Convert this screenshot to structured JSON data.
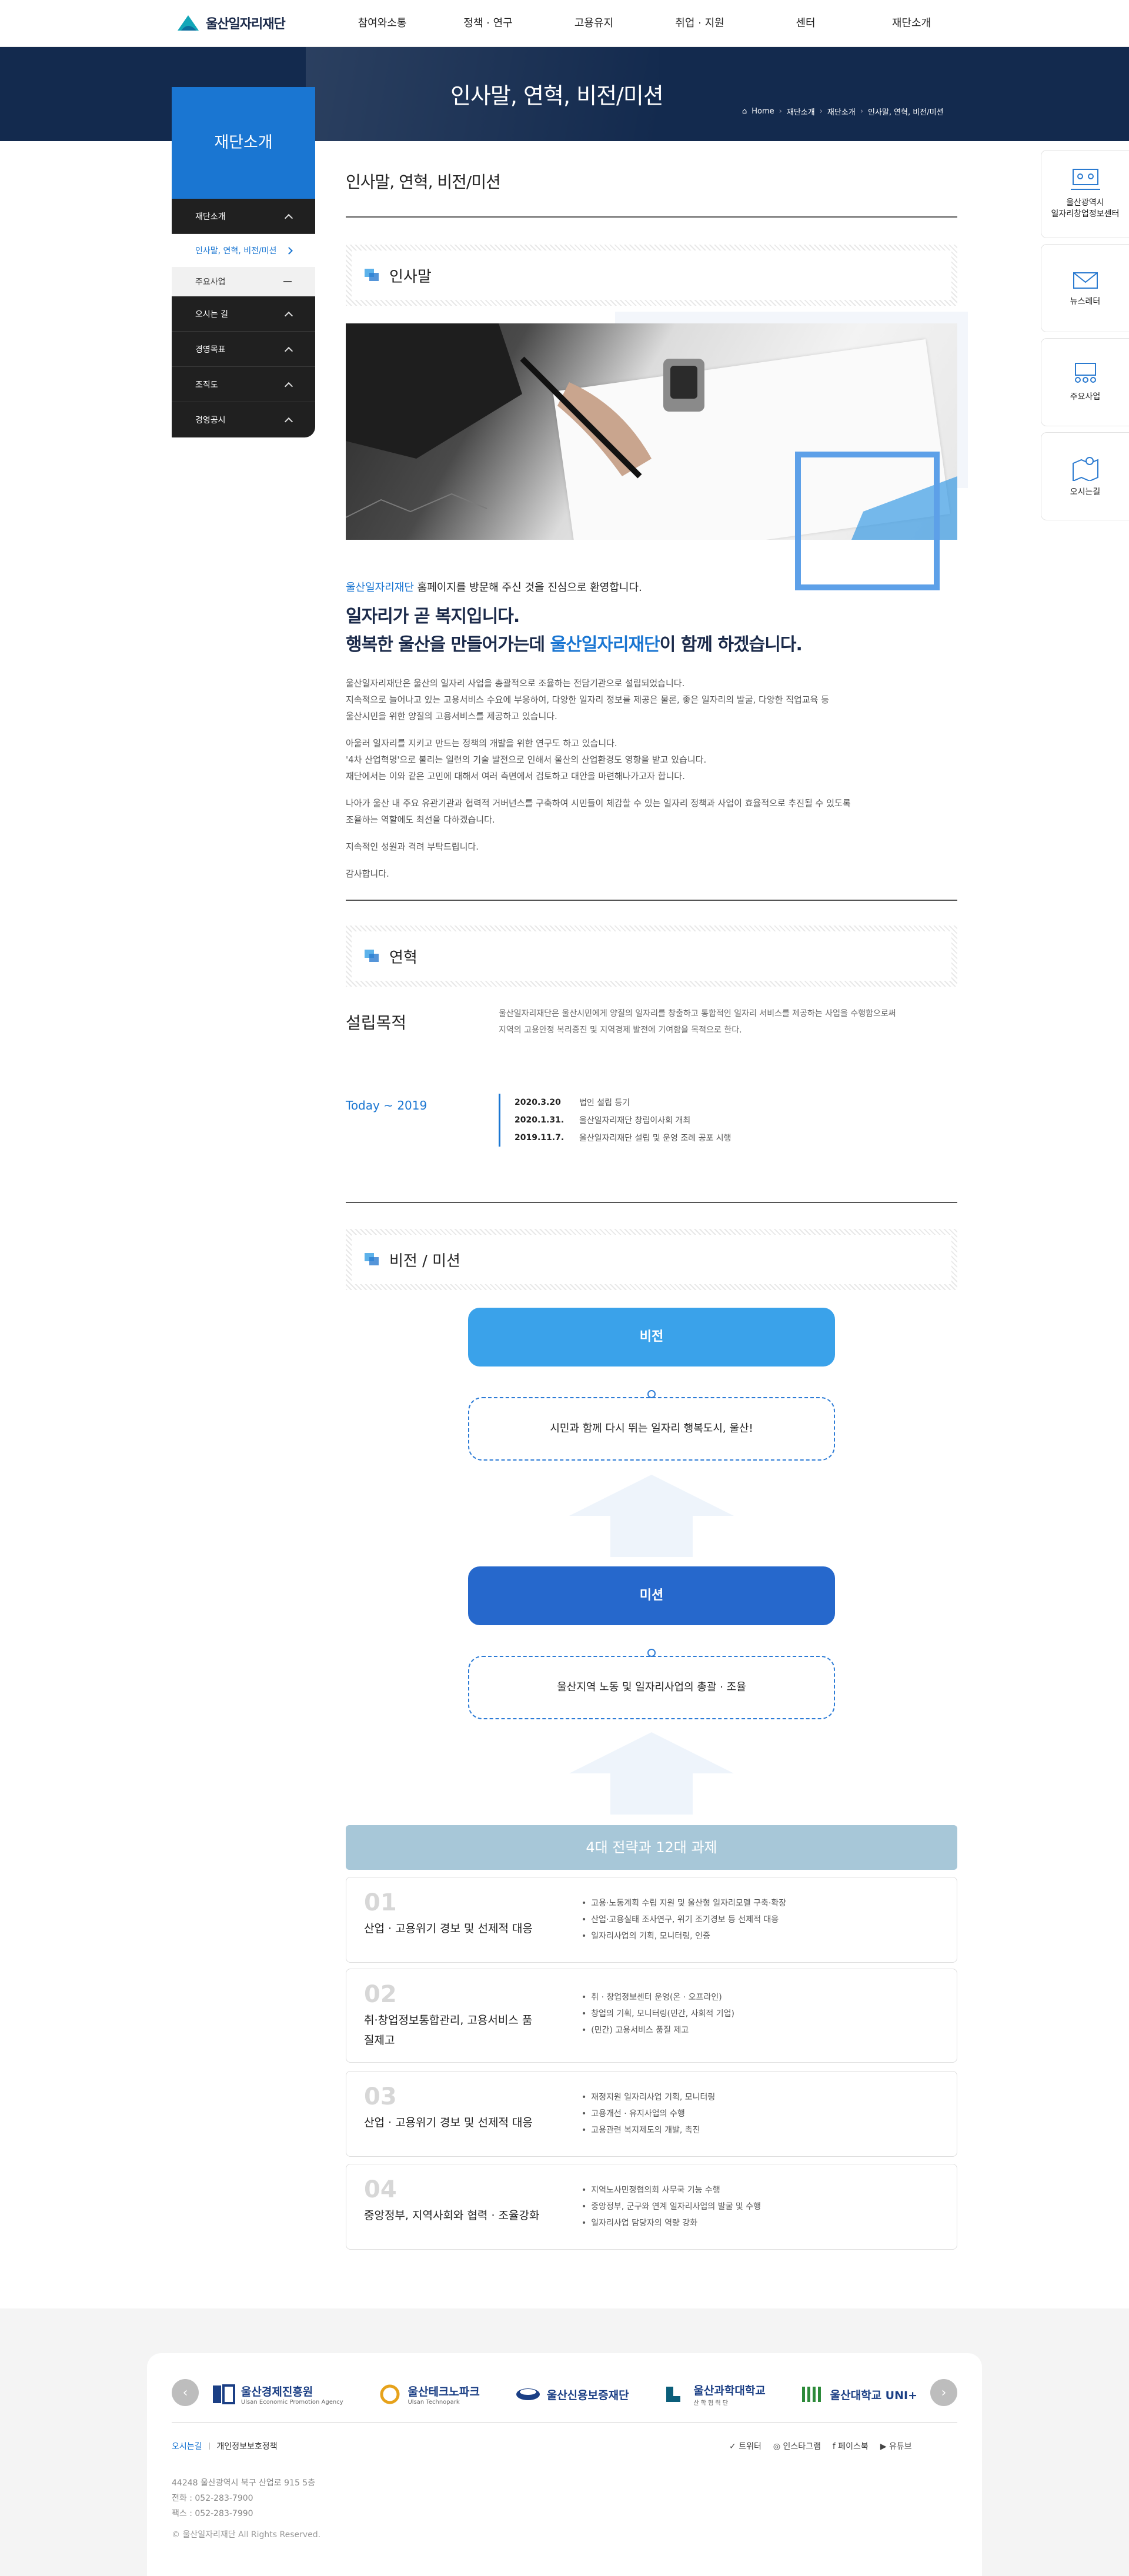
{
  "header": {
    "logo_text": "울산일자리재단",
    "nav": [
      "참여와소통",
      "정책 · 연구",
      "고용유지",
      "취업 · 지원",
      "센터",
      "재단소개"
    ]
  },
  "banner": {
    "title": "인사말, 연혁, 비전/미션",
    "breadcrumb": [
      "Home",
      "재단소개",
      "재단소개",
      "인사말, 연혁, 비전/미션"
    ]
  },
  "sidebar": {
    "heading": "재단소개",
    "items": [
      {
        "label": "재단소개"
      },
      {
        "label": "인사말, 연혁, 비전/미션"
      },
      {
        "label": "주요사업"
      },
      {
        "label": "오시는 길"
      },
      {
        "label": "경영목표"
      },
      {
        "label": "조직도"
      },
      {
        "label": "경영공시"
      }
    ]
  },
  "quick": [
    {
      "label": "울산광역시\n일자리창업정보센터"
    },
    {
      "label": "뉴스레터"
    },
    {
      "label": "주요사업"
    },
    {
      "label": "오시는길"
    }
  ],
  "page": {
    "title": "인사말, 연혁, 비전/미션"
  },
  "greeting": {
    "section_title": "인사말",
    "lead_hl": "울산일자리재단",
    "lead_rest": " 홈페이지를 방문해 주신 것을 진심으로 환영합니다.",
    "big_line1": "일자리가 곧 복지입니다.",
    "big_line2_a": "행복한 울산을 만들어가는데 ",
    "big_line2_hl": "울산일자리재단",
    "big_line2_b": "이 함께 하겠습니다.",
    "p1a": "울산일자리재단은 울산의 일자리 사업을 총괄적으로 조율하는 전담기관으로 설립되었습니다.",
    "p1b": "지속적으로 늘어나고 있는 고용서비스 수요에 부응하여, 다양한 일자리 정보를 제공은 물론, 좋은 일자리의 발굴, 다양한 직업교육 등",
    "p1c": "울산시민을 위한 양질의 고용서비스를 제공하고 있습니다.",
    "p2a": "아울러 일자리를 지키고 만드는 정책의 개발을 위한 연구도 하고 있습니다.",
    "p2b": "'4차 산업혁명'으로 불리는 일련의 기술 발전으로 인해서 울산의 산업환경도 영향을 받고 있습니다.",
    "p2c": "재단에서는 이와 같은 고민에 대해서 여러 측면에서 검토하고 대안을 마련해나가고자 합니다.",
    "p3a": "나아가 울산 내 주요 유관기관과 협력적 거버넌스를 구축하여 시민들이 체감할 수 있는 일자리 정책과 사업이 효율적으로 추진될 수 있도록",
    "p3b": "조율하는 역할에도 최선을 다하겠습니다.",
    "p4": "지속적인 성원과 격려 부탁드립니다.",
    "p5": "감사합니다."
  },
  "history": {
    "section_title": "연혁",
    "est_label": "설립목적",
    "est_text_a": "울산일자리재단은 울산시민에게 양질의 일자리를 창출하고 통합적인 일자리 서비스를 제공하는 사업을 수행함으로써",
    "est_text_b": "지역의 고용안정 복리증진 및 지역경제 발전에 기여함을 목적으로 한다.",
    "period_label": "Today ~ 2019",
    "events": [
      {
        "date": "2020.3.20",
        "text": "법인 설립 등기"
      },
      {
        "date": "2020.1.31.",
        "text": "울산일자리재단 창립이사회 개최"
      },
      {
        "date": "2019.11.7.",
        "text": "울산일자리재단 설립 및 운영 조례 공포 시행"
      }
    ]
  },
  "vision": {
    "section_title": "비전 / 미션",
    "vision_label": "비전",
    "vision_text": "시민과 함께 다시 뛰는 일자리 행복도시, 울산!",
    "mission_label": "미션",
    "mission_text": "울산지역 노동 및 일자리사업의 총괄 · 조율",
    "strategy_heading": "4대 전략과 12대 과제",
    "strategies": [
      {
        "num": "01",
        "title": "산업 · 고용위기 경보 및 선제적 대응",
        "tasks": [
          "고용·노동계획 수립 지원 및 울산형 일자리모델 구축·확장",
          "산업·고용실태 조사연구, 위기 조기경보 등 선제적 대응",
          "일자리사업의 기획, 모니터링, 인증"
        ]
      },
      {
        "num": "02",
        "title": "취·창업정보통합관리, 고용서비스 품질제고",
        "tasks": [
          "취 · 창업정보센터 운영(온 · 오프라인)",
          "창업의 기획, 모니터링(민간, 사회적 기업)",
          "(민간) 고용서비스 품질 제고"
        ]
      },
      {
        "num": "03",
        "title": "산업 · 고용위기 경보 및 선제적 대응",
        "tasks": [
          "재정지원 일자리사업 기획, 모니터링",
          "고용개선 · 유지사업의 수행",
          "고용관련 복지제도의 개발, 촉진"
        ]
      },
      {
        "num": "04",
        "title": "중앙정부, 지역사회와 협력 · 조율강화",
        "tasks": [
          "지역노사민정협의회 사무국 기능 수행",
          "중앙정부, 군구와 연계 일자리사업의 발굴 및 수행",
          "일자리사업 담당자의 역량 강화"
        ]
      }
    ]
  },
  "footer": {
    "partners": [
      {
        "name": "울산경제진흥원",
        "sub": "Ulsan Economic Promotion Agency"
      },
      {
        "name": "울산테크노파크",
        "sub": "Ulsan Technopark"
      },
      {
        "name": "울산신용보증재단",
        "sub": ""
      },
      {
        "name": "울산과학대학교",
        "sub": "산 학 협 력 단"
      },
      {
        "name": "울산대학교 UNI+",
        "sub": ""
      }
    ],
    "prev": "‹",
    "next": "›",
    "link_directions": "오시는길",
    "link_privacy": "개인정보보호정책",
    "sns": [
      "트위터",
      "인스타그램",
      "페이스북",
      "유튜브"
    ],
    "address": "44248 울산광역시 북구 산업로 915 5층",
    "tel": "전화 : 052-283-7900",
    "fax": "팩스 : 052-283-7990",
    "copyright": "© 울산일자리재단 All Rights Reserved."
  },
  "colors": {
    "brand_blue": "#1a76d2",
    "navy": "#132a4e",
    "vision_pill": "#3aa2ea",
    "mission_pill": "#2668cc",
    "strategy_head": "#a7c7d8"
  }
}
